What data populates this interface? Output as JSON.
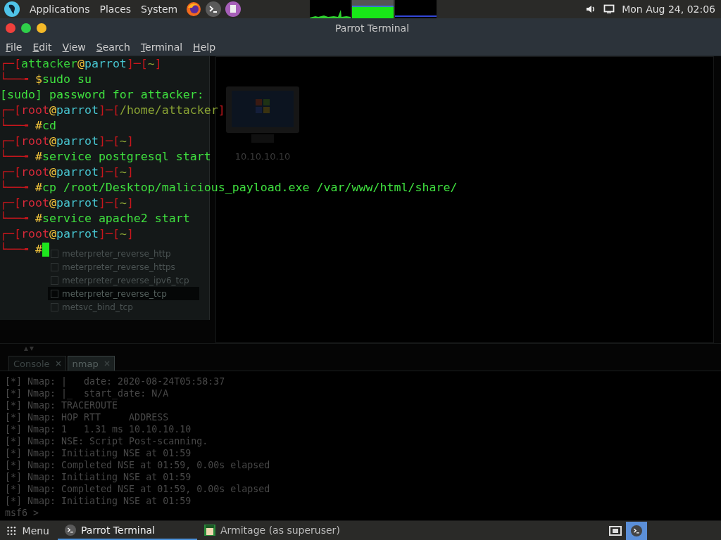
{
  "top_panel": {
    "menus": [
      {
        "label": "Applications"
      },
      {
        "label": "Places"
      },
      {
        "label": "System"
      }
    ],
    "clock": "Mon Aug 24, 02:06"
  },
  "window": {
    "title": "Parrot Terminal",
    "menu": [
      {
        "label": "File"
      },
      {
        "label": "Edit"
      },
      {
        "label": "View"
      },
      {
        "label": "Search"
      },
      {
        "label": "Terminal"
      },
      {
        "label": "Help"
      }
    ]
  },
  "terminal": {
    "lines": [
      {
        "cursor": false,
        "segments": [
          {
            "text": "┌─[",
            "color": "#c8161c"
          },
          {
            "text": "attacker",
            "color": "#37d13a"
          },
          {
            "text": "@",
            "color": "#f2c43c"
          },
          {
            "text": "parrot",
            "color": "#47c4cf"
          },
          {
            "text": "]─[",
            "color": "#c8161c"
          },
          {
            "text": "~",
            "color": "#8ba434"
          },
          {
            "text": "]",
            "color": "#c8161c"
          }
        ]
      },
      {
        "cursor": false,
        "segments": [
          {
            "text": "└──╼ ",
            "color": "#c8161c"
          },
          {
            "text": "$",
            "color": "#f2c43c"
          },
          {
            "text": "sudo su",
            "color": "#3fe03f"
          }
        ]
      },
      {
        "cursor": false,
        "segments": [
          {
            "text": "[sudo] password for attacker:",
            "color": "#3fe03f"
          }
        ]
      },
      {
        "cursor": false,
        "segments": [
          {
            "text": "┌─[",
            "color": "#c8161c"
          },
          {
            "text": "root",
            "color": "#d82a3a"
          },
          {
            "text": "@",
            "color": "#f2c43c"
          },
          {
            "text": "parrot",
            "color": "#47c4cf"
          },
          {
            "text": "]─[",
            "color": "#c8161c"
          },
          {
            "text": "/home/attacker",
            "color": "#8ba434"
          },
          {
            "text": "]",
            "color": "#c8161c"
          }
        ]
      },
      {
        "cursor": false,
        "segments": [
          {
            "text": "└──╼ ",
            "color": "#c8161c"
          },
          {
            "text": "#",
            "color": "#f2c43c"
          },
          {
            "text": "cd",
            "color": "#3fe03f"
          }
        ]
      },
      {
        "cursor": false,
        "segments": [
          {
            "text": "┌─[",
            "color": "#c8161c"
          },
          {
            "text": "root",
            "color": "#d82a3a"
          },
          {
            "text": "@",
            "color": "#f2c43c"
          },
          {
            "text": "parrot",
            "color": "#47c4cf"
          },
          {
            "text": "]─[",
            "color": "#c8161c"
          },
          {
            "text": "~",
            "color": "#8ba434"
          },
          {
            "text": "]",
            "color": "#c8161c"
          }
        ]
      },
      {
        "cursor": false,
        "segments": [
          {
            "text": "└──╼ ",
            "color": "#c8161c"
          },
          {
            "text": "#",
            "color": "#f2c43c"
          },
          {
            "text": "service postgresql start",
            "color": "#3fe03f"
          }
        ]
      },
      {
        "cursor": false,
        "segments": [
          {
            "text": "┌─[",
            "color": "#c8161c"
          },
          {
            "text": "root",
            "color": "#d82a3a"
          },
          {
            "text": "@",
            "color": "#f2c43c"
          },
          {
            "text": "parrot",
            "color": "#47c4cf"
          },
          {
            "text": "]─[",
            "color": "#c8161c"
          },
          {
            "text": "~",
            "color": "#8ba434"
          },
          {
            "text": "]",
            "color": "#c8161c"
          }
        ]
      },
      {
        "cursor": false,
        "segments": [
          {
            "text": "└──╼ ",
            "color": "#c8161c"
          },
          {
            "text": "#",
            "color": "#f2c43c"
          },
          {
            "text": "cp /root/Desktop/malicious_payload.exe /var/www/html/share/",
            "color": "#3fe03f"
          }
        ]
      },
      {
        "cursor": false,
        "segments": [
          {
            "text": "┌─[",
            "color": "#c8161c"
          },
          {
            "text": "root",
            "color": "#d82a3a"
          },
          {
            "text": "@",
            "color": "#f2c43c"
          },
          {
            "text": "parrot",
            "color": "#47c4cf"
          },
          {
            "text": "]─[",
            "color": "#c8161c"
          },
          {
            "text": "~",
            "color": "#8ba434"
          },
          {
            "text": "]",
            "color": "#c8161c"
          }
        ]
      },
      {
        "cursor": false,
        "segments": [
          {
            "text": "└──╼ ",
            "color": "#c8161c"
          },
          {
            "text": "#",
            "color": "#f2c43c"
          },
          {
            "text": "service apache2 start",
            "color": "#3fe03f"
          }
        ]
      },
      {
        "cursor": false,
        "segments": [
          {
            "text": "┌─[",
            "color": "#c8161c"
          },
          {
            "text": "root",
            "color": "#d82a3a"
          },
          {
            "text": "@",
            "color": "#f2c43c"
          },
          {
            "text": "parrot",
            "color": "#47c4cf"
          },
          {
            "text": "]─[",
            "color": "#c8161c"
          },
          {
            "text": "~",
            "color": "#8ba434"
          },
          {
            "text": "]",
            "color": "#c8161c"
          }
        ]
      },
      {
        "cursor": true,
        "segments": [
          {
            "text": "└──╼ ",
            "color": "#c8161c"
          },
          {
            "text": "#",
            "color": "#f2c43c"
          }
        ]
      }
    ]
  },
  "armitage": {
    "modules": [
      {
        "label": "meterpreter_reverse_http",
        "selected": false
      },
      {
        "label": "meterpreter_reverse_https",
        "selected": false
      },
      {
        "label": "meterpreter_reverse_ipv6_tcp",
        "selected": false
      },
      {
        "label": "meterpreter_reverse_tcp",
        "selected": true
      },
      {
        "label": "metsvc_bind_tcp",
        "selected": false
      }
    ],
    "hosts": [
      {
        "label": "10.10.10.10"
      }
    ],
    "tabs": [
      {
        "label": "Console",
        "selected": false
      },
      {
        "label": "nmap",
        "selected": true
      }
    ],
    "console": {
      "lines": [
        "[*] Nmap: |   date: 2020-08-24T05:58:37",
        "[*] Nmap: |_  start_date: N/A",
        "[*] Nmap: TRACEROUTE",
        "[*] Nmap: HOP RTT     ADDRESS",
        "[*] Nmap: 1   1.31 ms 10.10.10.10",
        "[*] Nmap: NSE: Script Post-scanning.",
        "[*] Nmap: Initiating NSE at 01:59",
        "[*] Nmap: Completed NSE at 01:59, 0.00s elapsed",
        "[*] Nmap: Initiating NSE at 01:59",
        "[*] Nmap: Completed NSE at 01:59, 0.00s elapsed",
        "[*] Nmap: Initiating NSE at 01:59"
      ],
      "prompt": "msf6 >"
    }
  },
  "taskbar": {
    "menu_label": "Menu",
    "tasks": [
      {
        "label": "Parrot Terminal",
        "kind": "terminal",
        "selected": true
      },
      {
        "label": "Armitage (as superuser)",
        "kind": "armitage",
        "selected": false
      }
    ]
  }
}
